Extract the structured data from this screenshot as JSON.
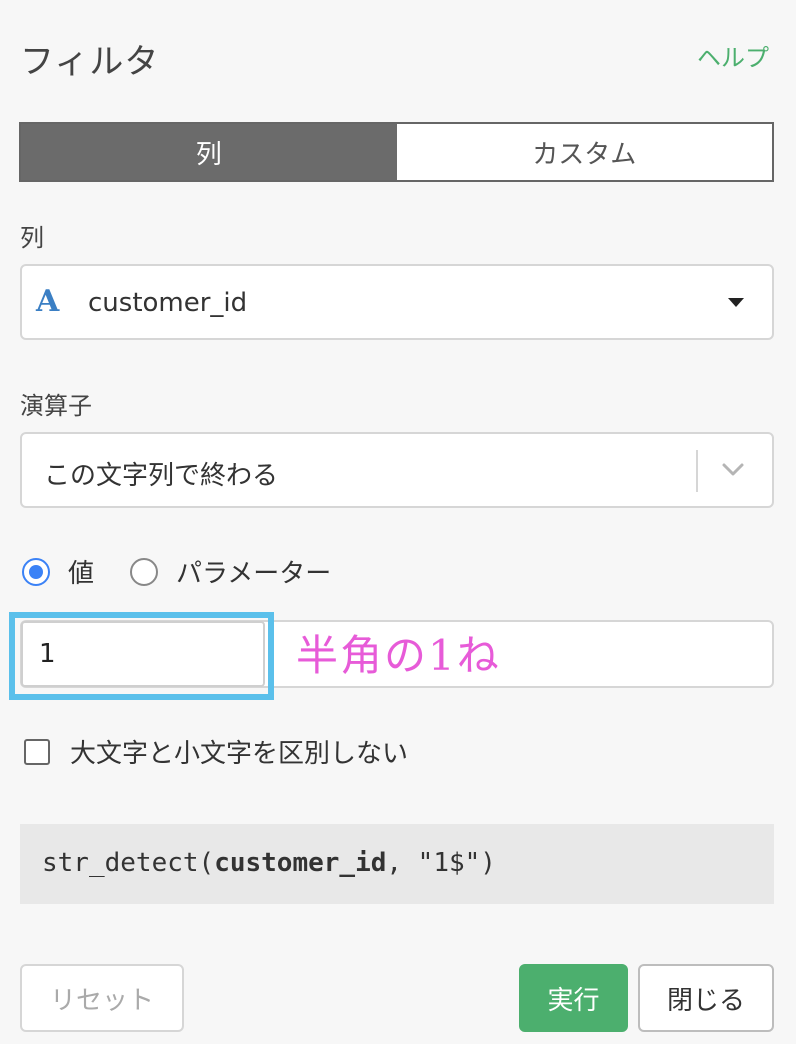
{
  "header": {
    "title": "フィルタ",
    "help_label": "ヘルプ"
  },
  "tabs": [
    {
      "label": "列",
      "active": true
    },
    {
      "label": "カスタム",
      "active": false
    }
  ],
  "column_section": {
    "label": "列",
    "type_icon_glyph": "A",
    "selected_column": "customer_id"
  },
  "operator_section": {
    "label": "演算子",
    "selected_operator": "この文字列で終わる"
  },
  "mode_radios": [
    {
      "label": "値",
      "checked": true
    },
    {
      "label": "パラメーター",
      "checked": false
    }
  ],
  "value_input": {
    "value": "1"
  },
  "annotation": {
    "text": "半角の1ね",
    "color": "#e75bd8"
  },
  "case_checkbox": {
    "label": "大文字と小文字を区別しない",
    "checked": false
  },
  "code_preview": {
    "func": "str_detect(",
    "column": "customer_id",
    "rest": ", \"1$\")"
  },
  "buttons": {
    "reset": "リセット",
    "run": "実行",
    "close": "閉じる"
  },
  "colors": {
    "accent_green": "#4caf6e",
    "radio_blue": "#3b82f6",
    "highlight_blue": "#5bc0eb",
    "type_icon_blue": "#3b7fc4"
  }
}
